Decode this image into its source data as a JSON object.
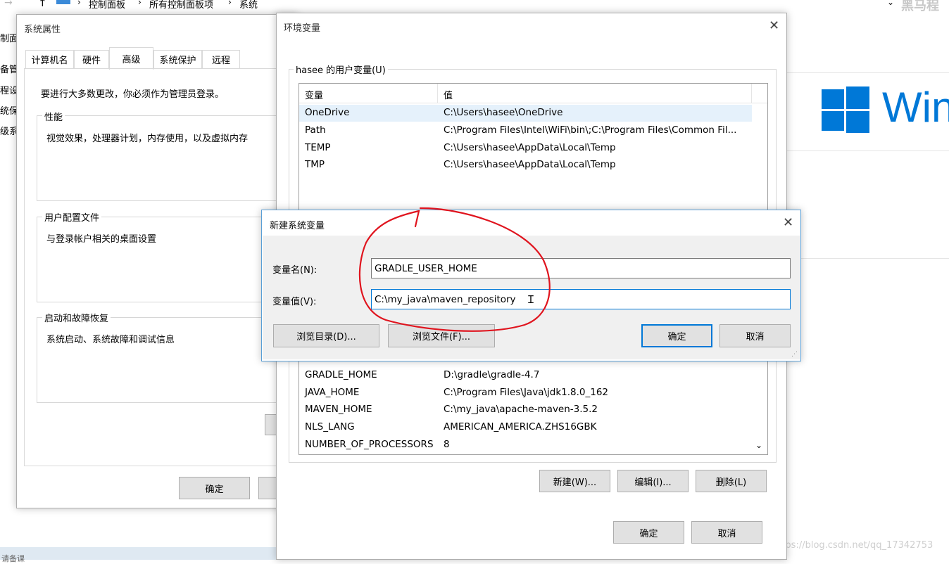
{
  "explorer": {
    "breadcrumbs": [
      "控制面板",
      "所有控制面板项",
      "系统"
    ],
    "left_links": [
      "制面",
      "备管",
      "程设",
      "统保",
      "级系"
    ],
    "bottom_text": "请备课",
    "windows_brand": "Win",
    "watermark_top": "黑马程",
    "watermark_url": "https://blog.csdn.net/qq_17342753"
  },
  "system_props": {
    "title": "系统属性",
    "tabs": [
      "计算机名",
      "硬件",
      "高级",
      "系统保护",
      "远程"
    ],
    "active_tab": "高级",
    "admin_note": "要进行大多数更改，你必须作为管理员登录。",
    "performance": {
      "label": "性能",
      "desc": "视觉效果，处理器计划，内存使用，以及虚拟内存"
    },
    "profiles": {
      "label": "用户配置文件",
      "desc": "与登录帐户相关的桌面设置"
    },
    "startup": {
      "label": "启动和故障恢复",
      "desc": "系统启动、系统故障和调试信息"
    },
    "ok_label": "确定"
  },
  "env_vars": {
    "title": "环境变量",
    "user_group_label": "hasee 的用户变量(U)",
    "col_var": "变量",
    "col_val": "值",
    "user_vars": [
      {
        "name": "OneDrive",
        "value": "C:\\Users\\hasee\\OneDrive"
      },
      {
        "name": "Path",
        "value": "C:\\Program Files\\Intel\\WiFi\\bin\\;C:\\Program Files\\Common Fil..."
      },
      {
        "name": "TEMP",
        "value": "C:\\Users\\hasee\\AppData\\Local\\Temp"
      },
      {
        "name": "TMP",
        "value": "C:\\Users\\hasee\\AppData\\Local\\Temp"
      }
    ],
    "system_vars": [
      {
        "name": "GRADLE_HOME",
        "value": "D:\\gradle\\gradle-4.7"
      },
      {
        "name": "JAVA_HOME",
        "value": "C:\\Program Files\\Java\\jdk1.8.0_162"
      },
      {
        "name": "MAVEN_HOME",
        "value": "C:\\my_java\\apache-maven-3.5.2"
      },
      {
        "name": "NLS_LANG",
        "value": "AMERICAN_AMERICA.ZHS16GBK"
      },
      {
        "name": "NUMBER_OF_PROCESSORS",
        "value": "8"
      }
    ],
    "new_label": "新建(W)...",
    "edit_label": "编辑(I)...",
    "delete_label": "删除(L)",
    "ok_label": "确定",
    "cancel_label": "取消"
  },
  "new_var_dialog": {
    "title": "新建系统变量",
    "name_label": "变量名(N):",
    "name_value": "GRADLE_USER_HOME",
    "value_label": "变量值(V):",
    "value_value": "C:\\my_java\\maven_repository",
    "browse_dir_label": "浏览目录(D)...",
    "browse_file_label": "浏览文件(F)...",
    "ok_label": "确定",
    "cancel_label": "取消"
  },
  "colors": {
    "accent": "#0078d7",
    "annotation": "#e0141e",
    "windows_blue": "#0078d7"
  }
}
